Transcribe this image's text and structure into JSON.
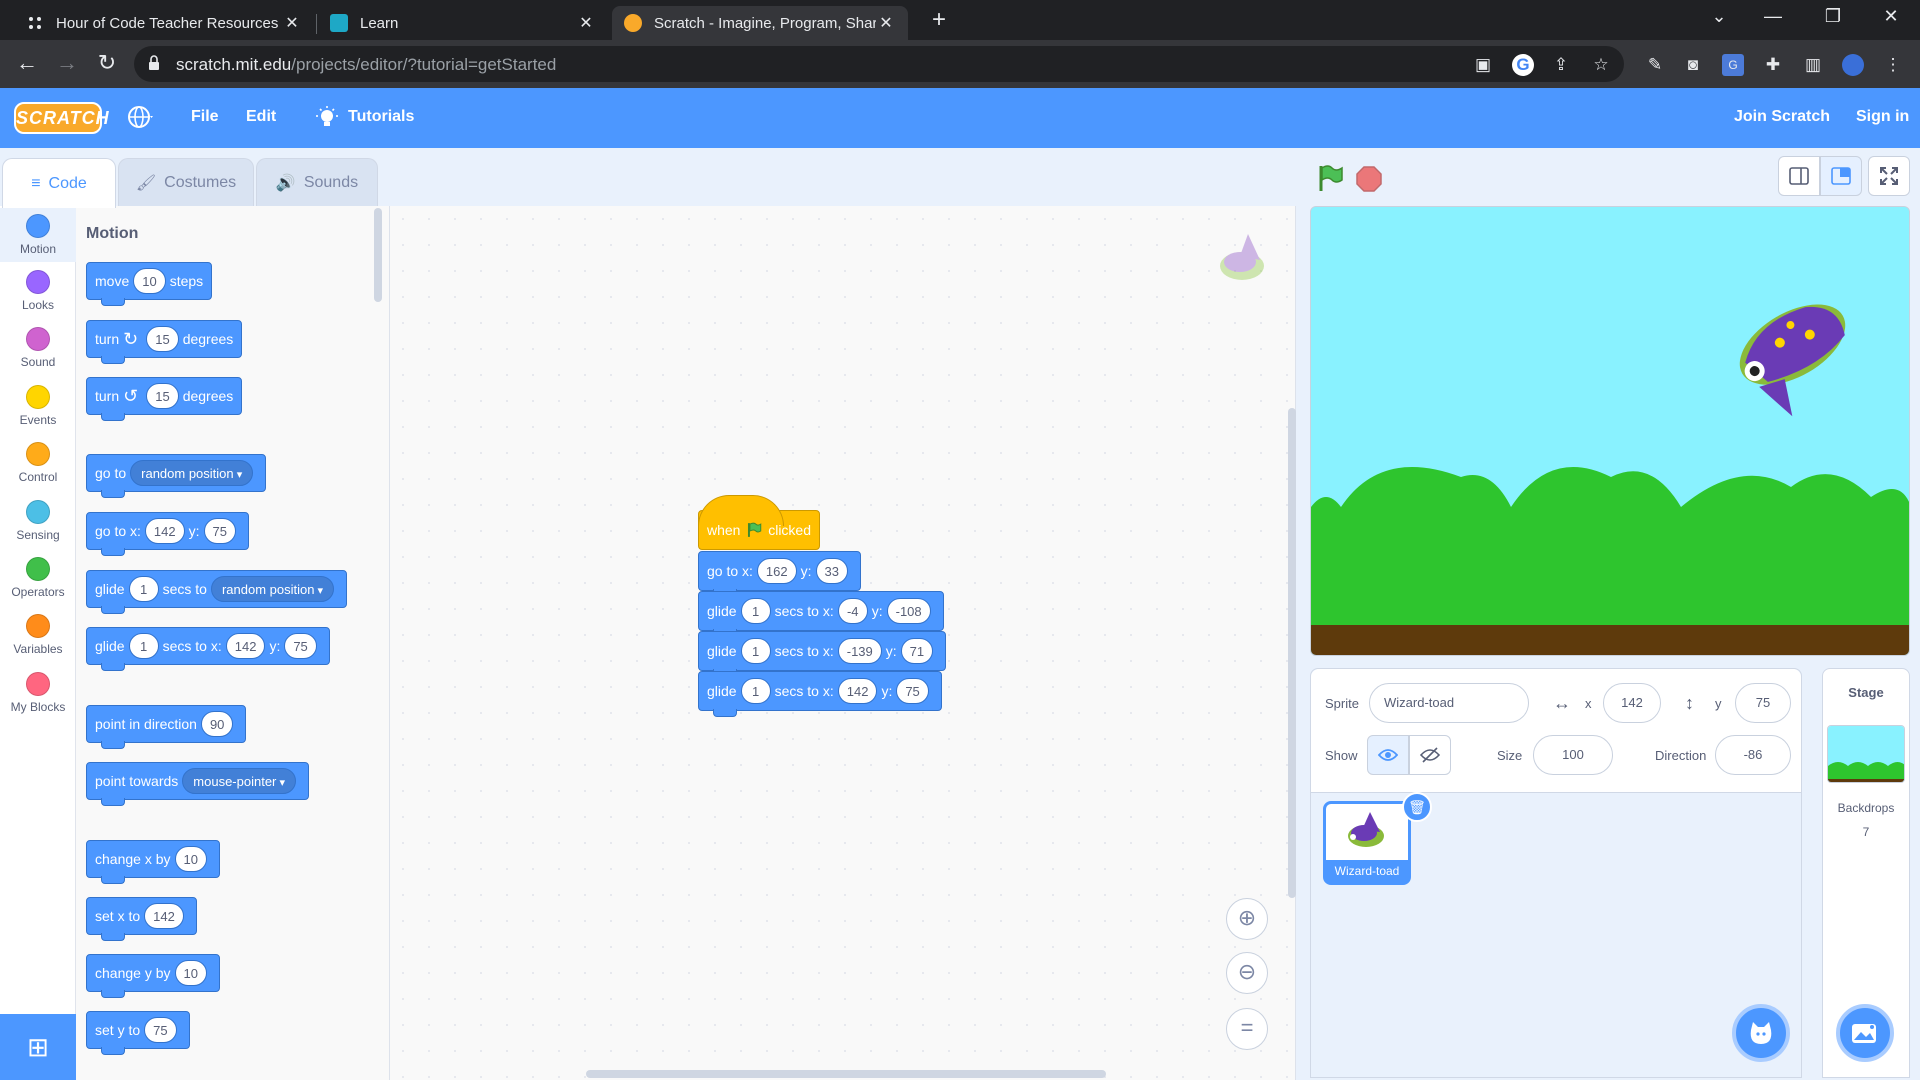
{
  "browser": {
    "tabs": [
      {
        "label": "Hour of Code Teacher Resources"
      },
      {
        "label": "Learn"
      },
      {
        "label": "Scratch - Imagine, Program, Share"
      }
    ],
    "url_host": "scratch.mit.edu",
    "url_path": "/projects/editor/?tutorial=getStarted"
  },
  "menubar": {
    "logo": "SCRATCH",
    "file": "File",
    "edit": "Edit",
    "tutorials": "Tutorials",
    "join": "Join Scratch",
    "signin": "Sign in"
  },
  "editor_tabs": {
    "code": "Code",
    "costumes": "Costumes",
    "sounds": "Sounds"
  },
  "categories": [
    {
      "label": "Motion",
      "color": "#4c97ff"
    },
    {
      "label": "Looks",
      "color": "#9966ff"
    },
    {
      "label": "Sound",
      "color": "#cf63cf"
    },
    {
      "label": "Events",
      "color": "#ffd500"
    },
    {
      "label": "Control",
      "color": "#ffab19"
    },
    {
      "label": "Sensing",
      "color": "#4cbfe6"
    },
    {
      "label": "Operators",
      "color": "#40bf4a"
    },
    {
      "label": "Variables",
      "color": "#ff8c1a"
    },
    {
      "label": "My Blocks",
      "color": "#ff6680"
    }
  ],
  "palette": {
    "title": "Motion",
    "move": {
      "a": "move",
      "v": "10",
      "b": "steps"
    },
    "turn_cw": {
      "a": "turn",
      "v": "15",
      "b": "degrees"
    },
    "turn_ccw": {
      "a": "turn",
      "v": "15",
      "b": "degrees"
    },
    "goto": {
      "a": "go to",
      "dd": "random position"
    },
    "gotoxy": {
      "a": "go to x:",
      "x": "142",
      "b": "y:",
      "y": "75"
    },
    "glide_to": {
      "a": "glide",
      "v": "1",
      "b": "secs to",
      "dd": "random position"
    },
    "glide_xy": {
      "a": "glide",
      "v": "1",
      "b": "secs to x:",
      "x": "142",
      "c": "y:",
      "y": "75"
    },
    "point_dir": {
      "a": "point in direction",
      "v": "90"
    },
    "point_towards": {
      "a": "point towards",
      "dd": "mouse-pointer"
    },
    "change_x": {
      "a": "change x by",
      "v": "10"
    },
    "set_x": {
      "a": "set x to",
      "v": "142"
    },
    "change_y": {
      "a": "change y by",
      "v": "10"
    },
    "set_y": {
      "a": "set y to",
      "v": "75"
    }
  },
  "script": {
    "hat": {
      "a": "when",
      "b": "clicked"
    },
    "goto": {
      "a": "go to x:",
      "x": "162",
      "b": "y:",
      "y": "33"
    },
    "glide1": {
      "a": "glide",
      "v": "1",
      "b": "secs to x:",
      "x": "-4",
      "c": "y:",
      "y": "-108"
    },
    "glide2": {
      "a": "glide",
      "v": "1",
      "b": "secs to x:",
      "x": "-139",
      "c": "y:",
      "y": "71"
    },
    "glide3": {
      "a": "glide",
      "v": "1",
      "b": "secs to x:",
      "x": "142",
      "c": "y:",
      "y": "75"
    }
  },
  "sprite_info": {
    "sprite_label": "Sprite",
    "sprite_name": "Wizard-toad",
    "x_label": "x",
    "x": "142",
    "y_label": "y",
    "y": "75",
    "show_label": "Show",
    "size_label": "Size",
    "size": "100",
    "direction_label": "Direction",
    "direction": "-86",
    "thumb_name": "Wizard-toad"
  },
  "stage_panel": {
    "title": "Stage",
    "backdrops_label": "Backdrops",
    "backdrops_count": "7"
  },
  "colors": {
    "accent": "#4c97ff",
    "events": "#ffbf00",
    "stage_sky": "#89f2ff",
    "hills": "#2ec52e",
    "ground": "#5e3a0c"
  }
}
